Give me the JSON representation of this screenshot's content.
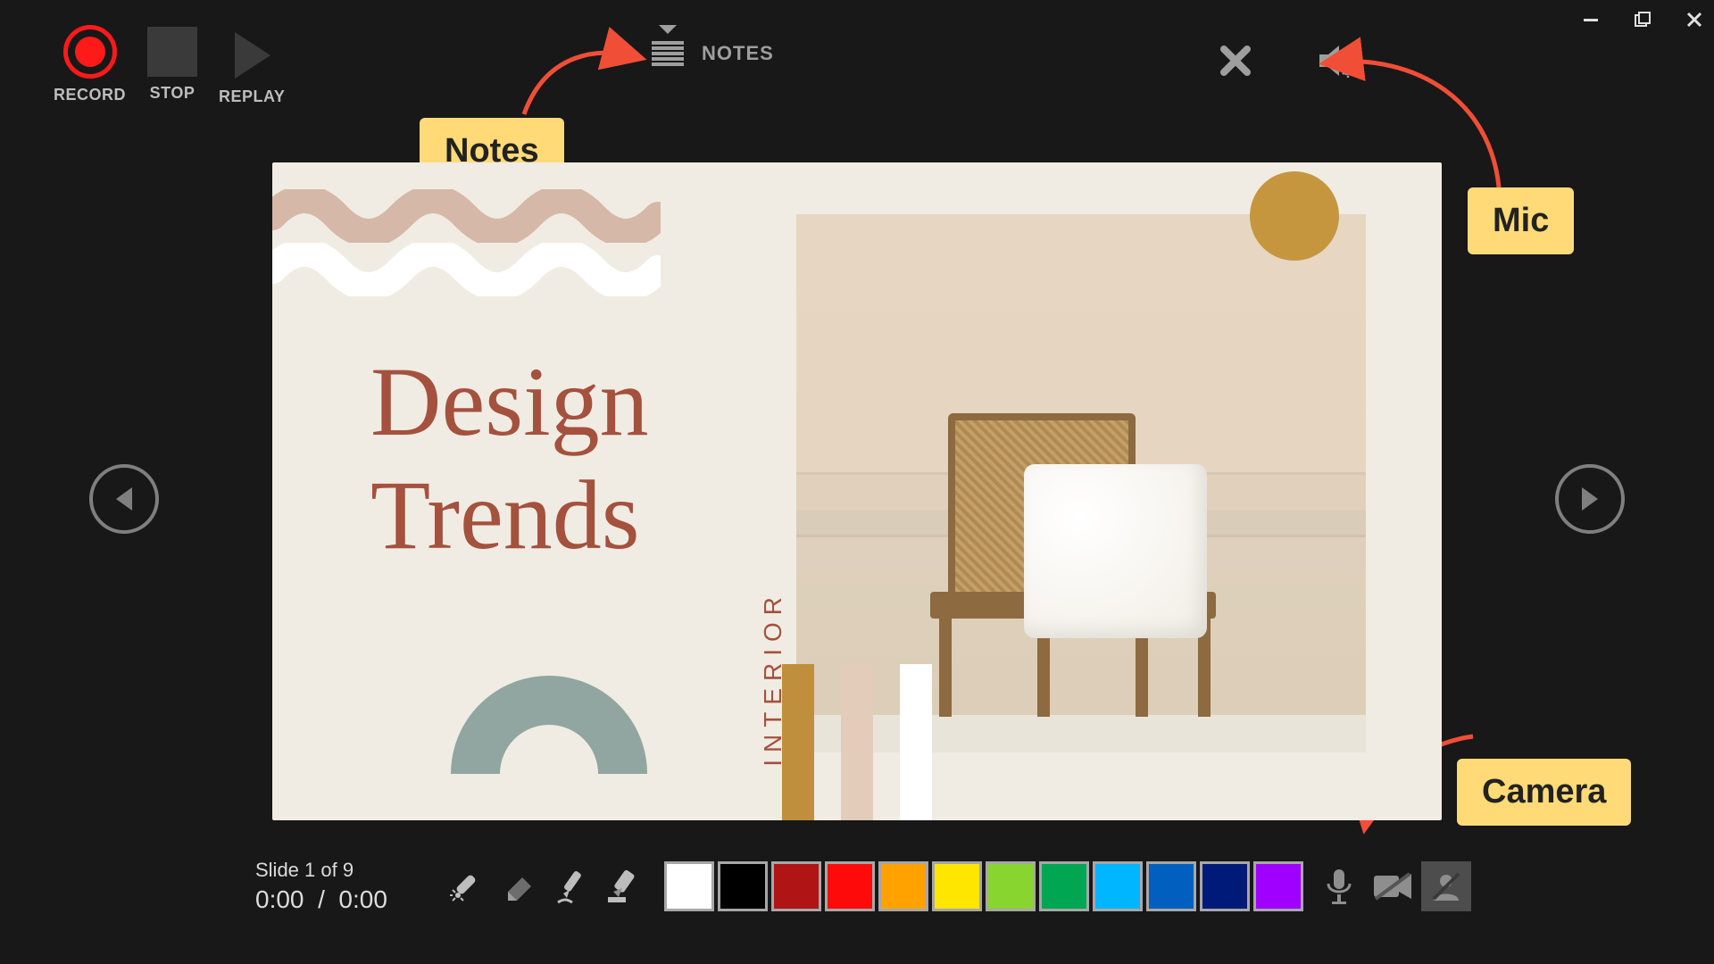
{
  "window_controls": {
    "minimize": "minimize",
    "maximize": "maximize",
    "close": "close"
  },
  "toolbar": {
    "record_label": "RECORD",
    "stop_label": "STOP",
    "replay_label": "REPLAY"
  },
  "top": {
    "notes_label": "NOTES",
    "clear_tooltip": "Clear",
    "audio_settings_tooltip": "Audio settings"
  },
  "annotations": {
    "notes": "Notes",
    "mic": "Mic",
    "camera": "Camera",
    "arrow_color": "#f04e37"
  },
  "slide": {
    "title_line1": "Design",
    "title_line2": "Trends",
    "side_label": "INTERIOR",
    "circle_color": "#c6963f",
    "swatches": [
      "#c08f3e",
      "#e3ccb9",
      "#ffffff"
    ],
    "accent_text_color": "#a4513e",
    "arch_color": "#91a6a0",
    "background": "#f0ece3"
  },
  "status": {
    "slide_counter": "Slide 1 of 9",
    "elapsed": "0:00",
    "separator": "/",
    "total": "0:00"
  },
  "palette": [
    "#ffffff",
    "#000000",
    "#b01414",
    "#ff0a0a",
    "#ffa200",
    "#ffe600",
    "#88d52f",
    "#00a651",
    "#00b7ff",
    "#005fbf",
    "#001a7a",
    "#a000ff"
  ],
  "pen_tools": [
    "laser-pointer",
    "eraser",
    "pen",
    "highlighter"
  ],
  "devices": {
    "mic": "microphone",
    "cam": "camera",
    "cameo": "cameo-off"
  }
}
